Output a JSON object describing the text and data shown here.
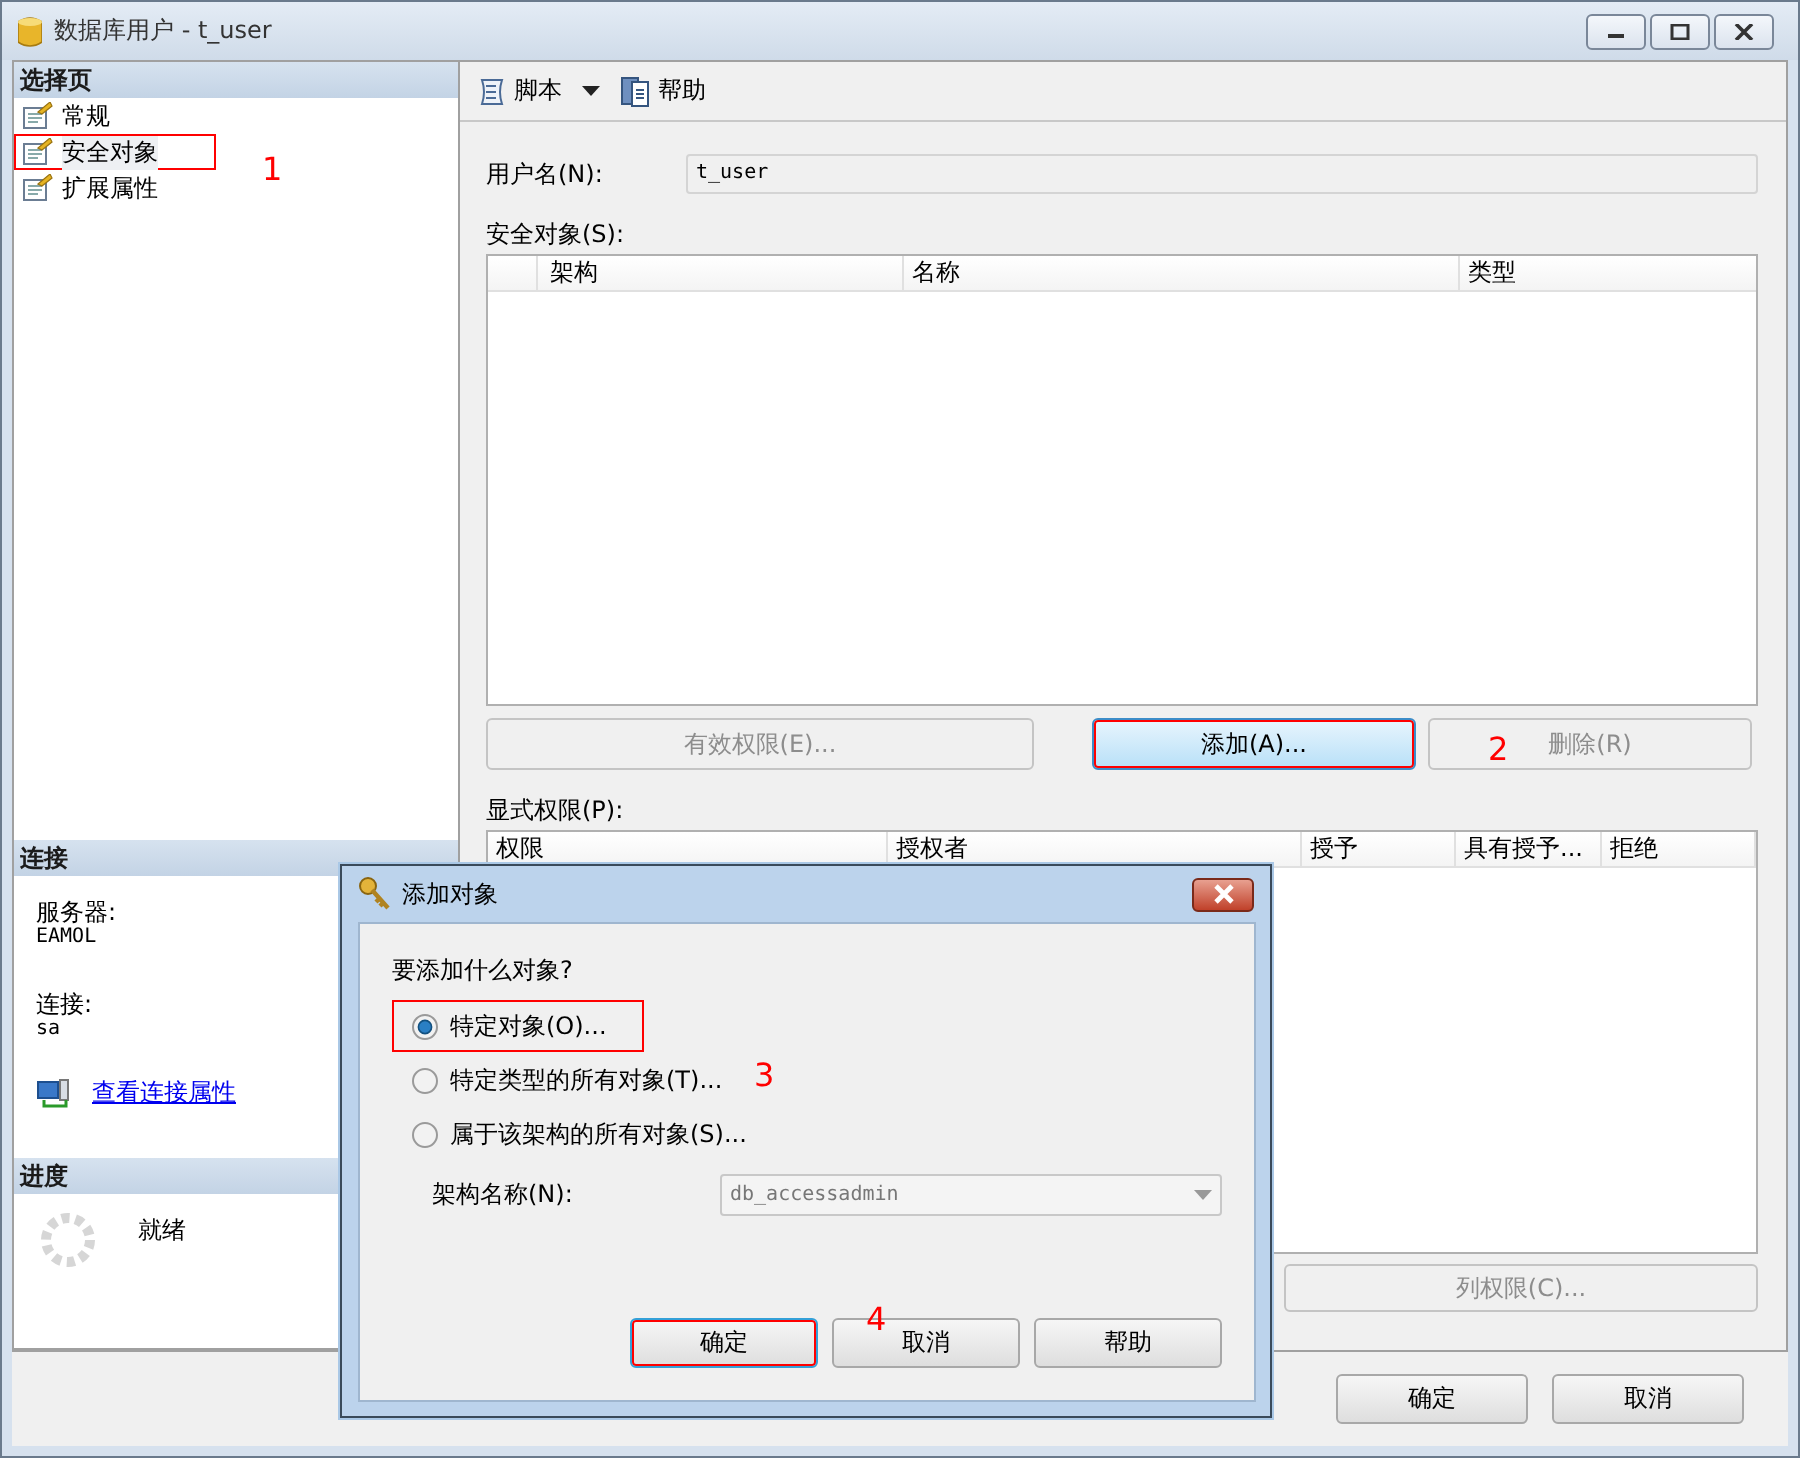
{
  "window": {
    "title": "数据库用户 - t_user"
  },
  "sidebar": {
    "pages_heading": "选择页",
    "pages": [
      {
        "label": "常规",
        "selected": false,
        "highlighted": false
      },
      {
        "label": "安全对象",
        "selected": true,
        "highlighted": true
      },
      {
        "label": "扩展属性",
        "selected": false,
        "highlighted": false
      }
    ],
    "connection_heading": "连接",
    "server_label": "服务器:",
    "server": "EAMOL",
    "connection_label": "连接:",
    "connection": "sa",
    "link": "查看连接属性",
    "progress_heading": "进度",
    "progress_status": "就绪"
  },
  "toolbar": [
    {
      "label": "脚本",
      "kind": "script"
    },
    {
      "label": "帮助",
      "kind": "help"
    }
  ],
  "user_name": {
    "label": "用户名(N):",
    "value": "t_user"
  },
  "securables": {
    "label": "安全对象(S):",
    "columns": [
      "架构",
      "名称",
      "类型"
    ]
  },
  "securable_buttons": [
    {
      "label": "有效权限(E)...",
      "disabled": true,
      "highlighted": false
    },
    {
      "label": "添加(A)...",
      "disabled": false,
      "highlighted": true
    },
    {
      "label": "删除(R)",
      "disabled": true,
      "highlighted": false
    }
  ],
  "permissions": {
    "label": "显式权限(P):",
    "columns": [
      "权限",
      "授权者",
      "授予",
      "具有授予...",
      "拒绝"
    ]
  },
  "column_permissions_button": {
    "label": "列权限(C)...",
    "disabled": true
  },
  "buttons": [
    "确定",
    "取消"
  ],
  "dialog": {
    "title": "添加对象",
    "question": "要添加什么对象?",
    "options": [
      {
        "label": "特定对象(O)...",
        "selected": true,
        "highlighted": true
      },
      {
        "label": "特定类型的所有对象(T)...",
        "selected": false,
        "highlighted": false
      },
      {
        "label": "属于该架构的所有对象(S)...",
        "selected": false,
        "highlighted": false
      }
    ],
    "schema": {
      "label": "架构名称(N):",
      "value": "db_accessadmin",
      "disabled": true
    },
    "buttons": [
      {
        "label": "确定",
        "highlighted": true
      },
      {
        "label": "取消",
        "highlighted": false
      },
      {
        "label": "帮助",
        "highlighted": false
      }
    ]
  },
  "annotations": [
    {
      "label": "1"
    },
    {
      "label": "2"
    },
    {
      "label": "3"
    },
    {
      "label": "4"
    }
  ]
}
